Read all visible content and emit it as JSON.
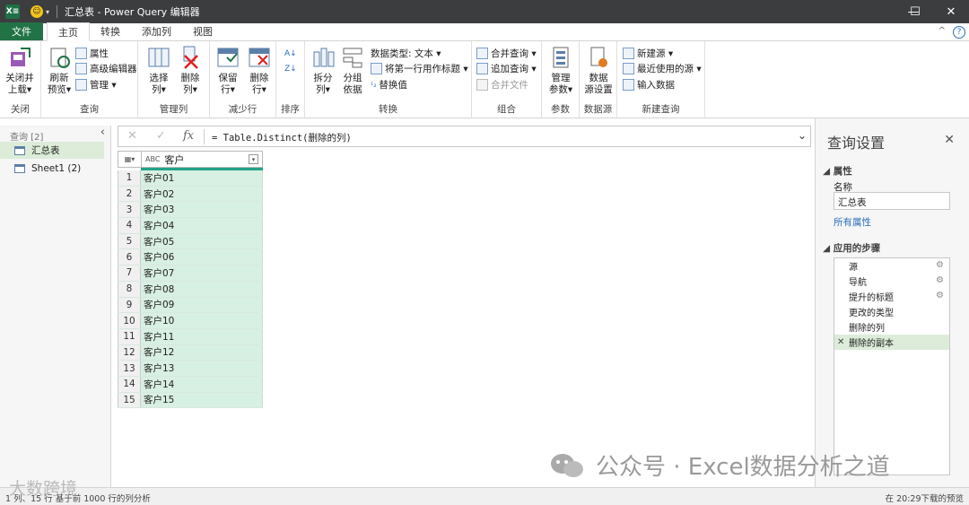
{
  "window": {
    "title": "汇总表 - Power Query 编辑器",
    "excel_logo": "X≡",
    "controls": {
      "minimize": "—",
      "maximize": "☐",
      "close": "✕"
    }
  },
  "menu": {
    "file": "文件",
    "tabs": [
      "主页",
      "转换",
      "添加列",
      "视图"
    ],
    "active_tab": "主页"
  },
  "ribbon": {
    "close": {
      "btn": "关闭并\n上载▾",
      "label": "关闭"
    },
    "query": {
      "refresh": "刷新\n预览▾",
      "props": "属性",
      "adv_editor": "高级编辑器",
      "manage": "管理 ▾",
      "label": "查询"
    },
    "cols": {
      "choose": "选择\n列▾",
      "remove": "删除\n列▾",
      "label": "管理列"
    },
    "rows": {
      "keep": "保留\n行▾",
      "remove": "删除\n行▾",
      "label": "减少行"
    },
    "sort": {
      "label": "排序"
    },
    "transform": {
      "split": "拆分\n列▾",
      "group": "分组\n依据",
      "dtype": "数据类型: 文本 ▾",
      "first_row": "将第一行用作标题 ▾",
      "replace": "替换值",
      "label": "转换"
    },
    "combine": {
      "merge": "合并查询 ▾",
      "append": "追加查询 ▾",
      "merge_files": "合并文件",
      "label": "组合"
    },
    "params": {
      "manage": "管理\n参数▾",
      "label": "参数"
    },
    "datasource": {
      "settings": "数据\n源设置",
      "label": "数据源"
    },
    "newquery": {
      "new_source": "新建源 ▾",
      "recent": "最近使用的源 ▾",
      "enter": "输入数据",
      "label": "新建查询"
    }
  },
  "sidebar": {
    "header": "查询 [2]",
    "items": [
      {
        "label": "汇总表",
        "selected": true
      },
      {
        "label": "Sheet1 (2)",
        "selected": false
      }
    ]
  },
  "formula_bar": {
    "formula": "= Table.Distinct(删除的列)",
    "fx": "fx"
  },
  "grid": {
    "column": "客户",
    "type_icon": "ABC",
    "rows": [
      "客户01",
      "客户02",
      "客户03",
      "客户04",
      "客户05",
      "客户06",
      "客户07",
      "客户08",
      "客户09",
      "客户10",
      "客户11",
      "客户12",
      "客户13",
      "客户14",
      "客户15"
    ]
  },
  "query_settings": {
    "title": "查询设置",
    "properties_header": "属性",
    "name_label": "名称",
    "name_value": "汇总表",
    "all_props": "所有属性",
    "steps_header": "应用的步骤",
    "steps": [
      {
        "label": "源",
        "gear": true
      },
      {
        "label": "导航",
        "gear": true
      },
      {
        "label": "提升的标题",
        "gear": true
      },
      {
        "label": "更改的类型",
        "gear": false
      },
      {
        "label": "删除的列",
        "gear": false
      },
      {
        "label": "删除的副本",
        "gear": false,
        "selected": true
      }
    ]
  },
  "status": {
    "left": "1 列、15 行    基于前 1000 行的列分析",
    "right": "在 20:29下载的预览"
  },
  "watermark": {
    "text": "公众号 · Excel数据分析之道",
    "sub": "大数跨境"
  }
}
